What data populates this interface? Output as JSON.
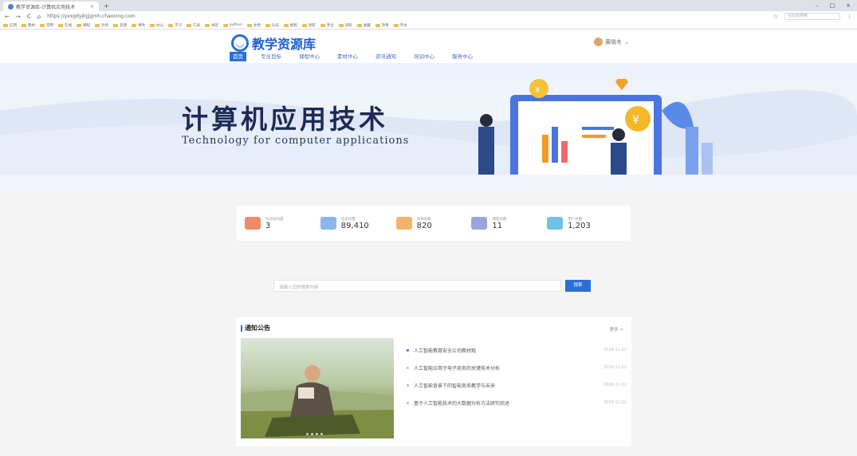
{
  "browser": {
    "tab_title": "教学资源库-计算机应用技术",
    "url": "https://yxxgdyjkjjjgmh.chaoxing.com",
    "search_placeholder": "在此处搜索",
    "bookmarks": [
      "应用",
      "教材",
      "常用",
      "在线",
      "课程",
      "计划",
      "资源",
      "课件",
      "办公",
      "学习",
      "工具",
      "书签",
      "python",
      "文档",
      "论坛",
      "视频",
      "导航",
      "专业",
      "资料",
      "收藏",
      "项目",
      "平台"
    ]
  },
  "site": {
    "logo_text": "教学资源库",
    "user_name": "黄晓冬",
    "nav": [
      "首页",
      "专业目标",
      "课程中心",
      "素材中心",
      "资讯通知",
      "培训中心",
      "服务中心"
    ]
  },
  "hero": {
    "title": "计算机应用技术",
    "subtitle": "Technology for computer applications"
  },
  "stats": [
    {
      "label": "今日访问量",
      "value": "3",
      "color": "#f08a6b"
    },
    {
      "label": "总访问量",
      "value": "89,410",
      "color": "#8ab6ea"
    },
    {
      "label": "资源总数",
      "value": "820",
      "color": "#f2b36b"
    },
    {
      "label": "课程总数",
      "value": "11",
      "color": "#9aa5dd"
    },
    {
      "label": "用户总数",
      "value": "1,203",
      "color": "#6fc1e8"
    }
  ],
  "search": {
    "placeholder": "请输入您的搜索内容",
    "button": "搜索"
  },
  "notice": {
    "title": "通知公告",
    "more": "更多 >",
    "items": [
      {
        "text": "人工智能教育安全公司教材观",
        "date": "2018-11-22"
      },
      {
        "text": "人工智能应用于电子商务的关键技术分析",
        "date": "2018-11-22"
      },
      {
        "text": "人工智能背景下的智能商务教学与未来",
        "date": "2018-11-22"
      },
      {
        "text": "基于人工智能技术的大数据分析方法研究综述",
        "date": "2018-11-22"
      }
    ]
  }
}
